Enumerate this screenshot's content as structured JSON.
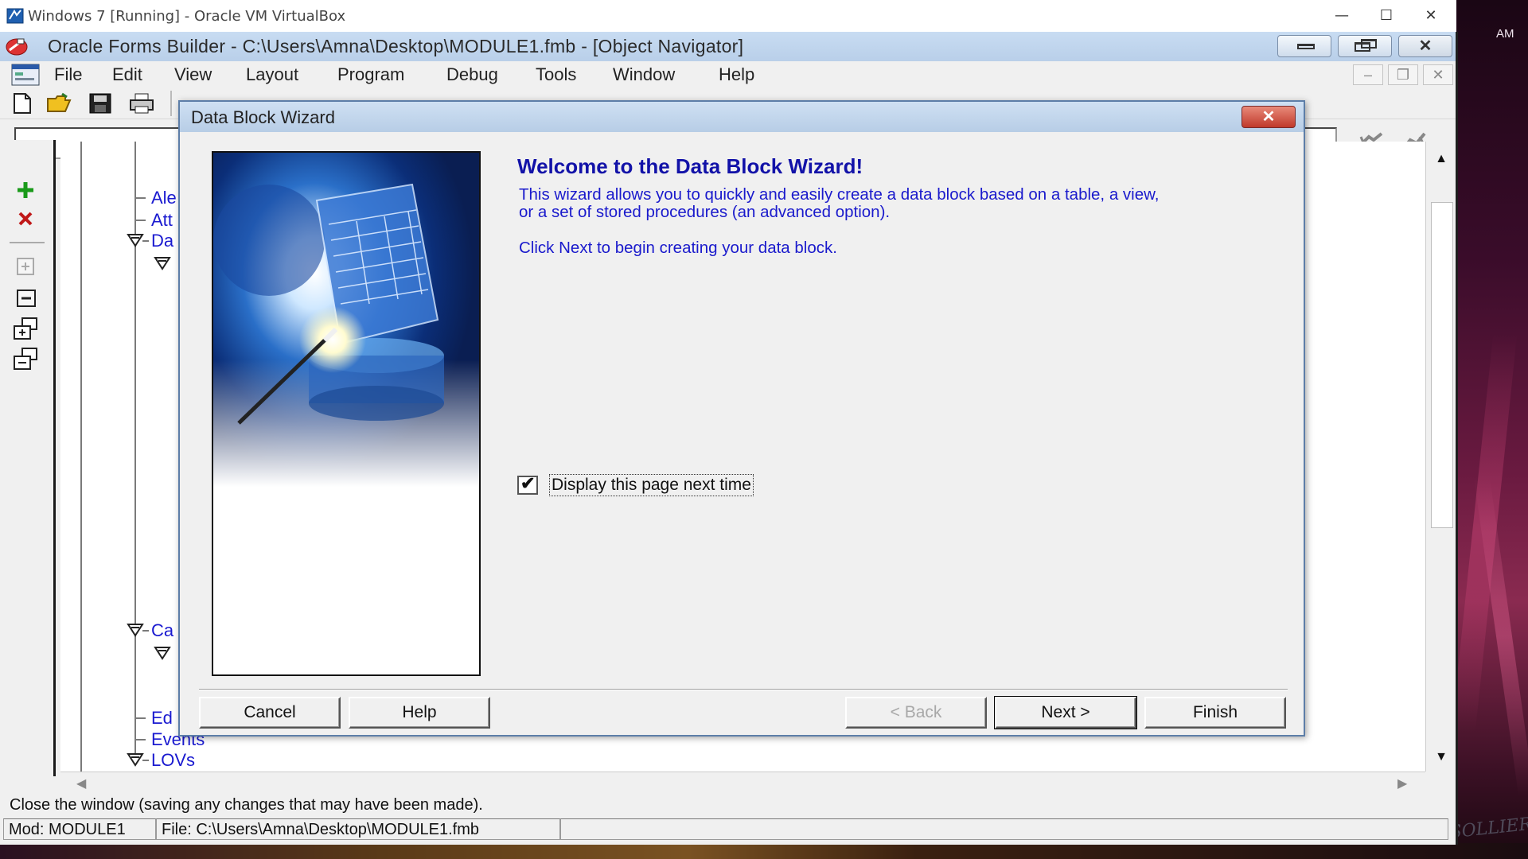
{
  "host_window": {
    "title": "Windows 7 [Running] - Oracle VM VirtualBox",
    "controls": {
      "minimize": "—",
      "maximize": "☐",
      "close": "✕"
    }
  },
  "desktop": {
    "clock": "AM",
    "signature": "RSOLLIER"
  },
  "app": {
    "title": "Oracle Forms Builder - C:\\Users\\Amna\\Desktop\\MODULE1.fmb - [Object Navigator]",
    "menu": [
      "File",
      "Edit",
      "View",
      "Layout",
      "Program",
      "Debug",
      "Tools",
      "Window",
      "Help"
    ],
    "mdi_controls": {
      "minimize": "–",
      "restore": "❐",
      "close": "✕"
    }
  },
  "navigator": {
    "tree": [
      {
        "label": "Ale"
      },
      {
        "label": "Att"
      },
      {
        "label": "Da"
      },
      {
        "label": "Ca"
      },
      {
        "label": "Ed"
      },
      {
        "label": "Events"
      },
      {
        "label": "LOVs"
      }
    ]
  },
  "status": {
    "message": "Close the window (saving any changes that may have been made).",
    "module": "Mod: MODULE1",
    "file": "File: C:\\Users\\Amna\\Desktop\\MODULE1.fmb"
  },
  "wizard": {
    "title": "Data Block Wizard",
    "heading": "Welcome to the Data Block Wizard!",
    "paragraph1_line1": "This wizard allows you to quickly and easily create a data block based on a table, a view,",
    "paragraph1_line2": "or a set of stored procedures (an advanced option).",
    "paragraph2": "Click Next to begin creating your data block.",
    "checkbox": {
      "label": "Display this page next time",
      "checked": true
    },
    "buttons": {
      "cancel": "Cancel",
      "help": "Help",
      "back": "< Back",
      "next": "Next >",
      "finish": "Finish"
    },
    "close_glyph": "✕"
  },
  "colors": {
    "tree_label": "#1a1ad0",
    "wizard_text": "#1a1acc",
    "title_gradient": "#b9cfe9"
  },
  "icons": {
    "toolbar": [
      "new-file-icon",
      "open-folder-icon",
      "save-icon",
      "print-icon"
    ],
    "vertical_toolbar": [
      "create-icon",
      "delete-icon",
      "expand-icon",
      "collapse-icon",
      "expand-all-icon",
      "collapse-all-icon"
    ],
    "search": [
      "search-previous-icon",
      "search-next-icon"
    ]
  }
}
